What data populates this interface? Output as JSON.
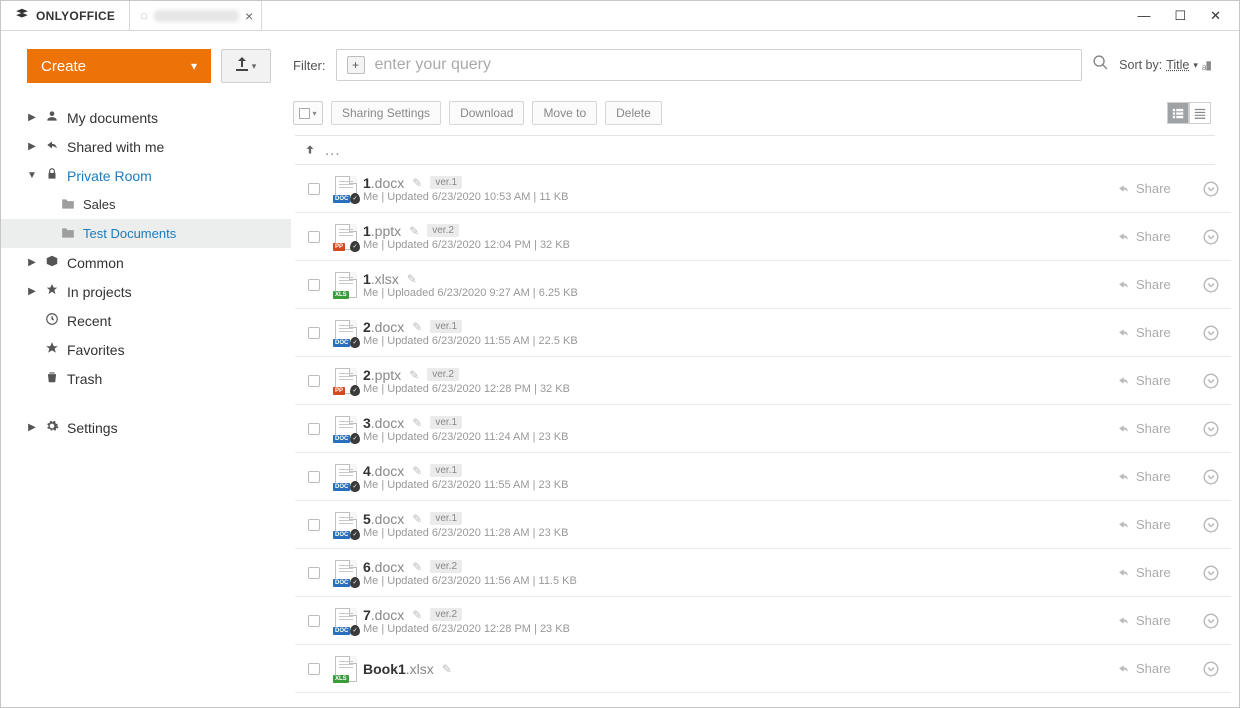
{
  "app": {
    "name": "ONLYOFFICE"
  },
  "wincontrols": {
    "min": "—",
    "max": "☐",
    "close": "✕"
  },
  "sidebar": {
    "create": "Create",
    "items": {
      "myDocs": "My documents",
      "shared": "Shared with me",
      "private": "Private Room",
      "sales": "Sales",
      "testDocs": "Test Documents",
      "common": "Common",
      "inProjects": "In projects",
      "recent": "Recent",
      "favorites": "Favorites",
      "trash": "Trash",
      "settings": "Settings"
    }
  },
  "filter": {
    "label": "Filter:",
    "placeholder": "enter your query",
    "sortBy": "Sort by:",
    "sortField": "Title"
  },
  "actions": {
    "sharing": "Sharing Settings",
    "download": "Download",
    "moveTo": "Move to",
    "delete": "Delete"
  },
  "up": {
    "dots": "..."
  },
  "shareLabel": "Share",
  "files": [
    {
      "base": "1",
      "ext": ".docx",
      "type": "docx",
      "ver": "ver.1",
      "meta": "Me  |  Updated 6/23/2020 10:53 AM  |  11 KB",
      "shield": true
    },
    {
      "base": "1",
      "ext": ".pptx",
      "type": "pptx",
      "ver": "ver.2",
      "meta": "Me  |  Updated 6/23/2020 12:04 PM  |  32 KB",
      "shield": true
    },
    {
      "base": "1",
      "ext": ".xlsx",
      "type": "xlsx",
      "ver": "",
      "meta": "Me  |  Uploaded 6/23/2020 9:27 AM  |  6.25 KB",
      "shield": false
    },
    {
      "base": "2",
      "ext": ".docx",
      "type": "docx",
      "ver": "ver.1",
      "meta": "Me  |  Updated 6/23/2020 11:55 AM  |  22.5 KB",
      "shield": true
    },
    {
      "base": "2",
      "ext": ".pptx",
      "type": "pptx",
      "ver": "ver.2",
      "meta": "Me  |  Updated 6/23/2020 12:28 PM  |  32 KB",
      "shield": true
    },
    {
      "base": "3",
      "ext": ".docx",
      "type": "docx",
      "ver": "ver.1",
      "meta": "Me  |  Updated 6/23/2020 11:24 AM  |  23 KB",
      "shield": true
    },
    {
      "base": "4",
      "ext": ".docx",
      "type": "docx",
      "ver": "ver.1",
      "meta": "Me  |  Updated 6/23/2020 11:55 AM  |  23 KB",
      "shield": true
    },
    {
      "base": "5",
      "ext": ".docx",
      "type": "docx",
      "ver": "ver.1",
      "meta": "Me  |  Updated 6/23/2020 11:28 AM  |  23 KB",
      "shield": true
    },
    {
      "base": "6",
      "ext": ".docx",
      "type": "docx",
      "ver": "ver.2",
      "meta": "Me  |  Updated 6/23/2020 11:56 AM  |  11.5 KB",
      "shield": true
    },
    {
      "base": "7",
      "ext": ".docx",
      "type": "docx",
      "ver": "ver.2",
      "meta": "Me  |  Updated 6/23/2020 12:28 PM  |  23 KB",
      "shield": true
    },
    {
      "base": "Book1",
      "ext": ".xlsx",
      "type": "xlsx",
      "ver": "",
      "meta": "",
      "shield": false
    }
  ]
}
